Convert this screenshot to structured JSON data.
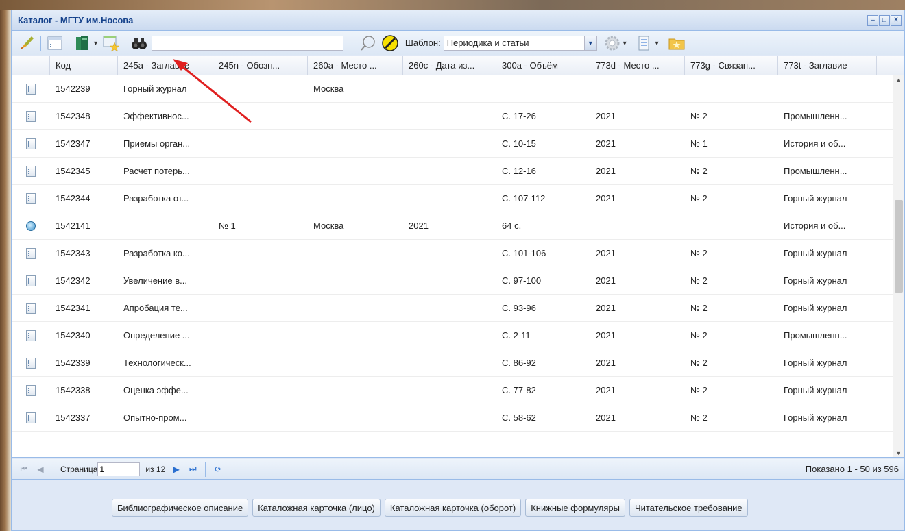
{
  "window": {
    "title": "Каталог - МГТУ им.Носова",
    "controls": [
      "–",
      "□",
      "✕"
    ]
  },
  "toolbar": {
    "search_value": "",
    "template_label": "Шаблон:",
    "template_value": "Периодика и статьи",
    "icons": [
      "edit-brush-icon",
      "record-view-icon",
      "books-icon",
      "favorite-record-icon",
      "binoculars-icon",
      "search-icon",
      "clear-icon",
      "settings-icon",
      "export-icon",
      "folder-star-icon"
    ]
  },
  "grid": {
    "columns": [
      "",
      "Код",
      "245a - Заглавие",
      "245n - Обозн...",
      "260a - Место ...",
      "260c - Дата из...",
      "300a - Объём",
      "773d - Место ...",
      "773g - Связан...",
      "773t - Заглавие"
    ],
    "rows": [
      {
        "icon": "doc",
        "code": "1542239",
        "title": "Горный журнал",
        "n": "",
        "place": "Москва",
        "date": "",
        "volume": "",
        "m773d": "",
        "m773g": "",
        "m773t": ""
      },
      {
        "icon": "doc",
        "code": "1542348",
        "title": "Эффективнос...",
        "n": "",
        "place": "",
        "date": "",
        "volume": "С. 17-26",
        "m773d": "2021",
        "m773g": "№ 2",
        "m773t": "Промышленн..."
      },
      {
        "icon": "doc",
        "code": "1542347",
        "title": "Приемы орган...",
        "n": "",
        "place": "",
        "date": "",
        "volume": "С. 10-15",
        "m773d": "2021",
        "m773g": "№ 1",
        "m773t": "История и об..."
      },
      {
        "icon": "doc",
        "code": "1542345",
        "title": "Расчет потерь...",
        "n": "",
        "place": "",
        "date": "",
        "volume": "С. 12-16",
        "m773d": "2021",
        "m773g": "№ 2",
        "m773t": "Промышленн..."
      },
      {
        "icon": "doc",
        "code": "1542344",
        "title": "Разработка от...",
        "n": "",
        "place": "",
        "date": "",
        "volume": "С. 107-112",
        "m773d": "2021",
        "m773g": "№ 2",
        "m773t": "Горный журнал"
      },
      {
        "icon": "globe",
        "code": "1542141",
        "title": "",
        "n": "№ 1",
        "place": "Москва",
        "date": "2021",
        "volume": "64 с.",
        "m773d": "",
        "m773g": "",
        "m773t": "История и об..."
      },
      {
        "icon": "doc",
        "code": "1542343",
        "title": "Разработка ко...",
        "n": "",
        "place": "",
        "date": "",
        "volume": "С. 101-106",
        "m773d": "2021",
        "m773g": "№ 2",
        "m773t": "Горный журнал"
      },
      {
        "icon": "doc",
        "code": "1542342",
        "title": "Увеличение в...",
        "n": "",
        "place": "",
        "date": "",
        "volume": "С. 97-100",
        "m773d": "2021",
        "m773g": "№ 2",
        "m773t": "Горный журнал"
      },
      {
        "icon": "doc",
        "code": "1542341",
        "title": "Апробация те...",
        "n": "",
        "place": "",
        "date": "",
        "volume": "С. 93-96",
        "m773d": "2021",
        "m773g": "№ 2",
        "m773t": "Горный журнал"
      },
      {
        "icon": "doc",
        "code": "1542340",
        "title": "Определение ...",
        "n": "",
        "place": "",
        "date": "",
        "volume": "С. 2-11",
        "m773d": "2021",
        "m773g": "№ 2",
        "m773t": "Промышленн..."
      },
      {
        "icon": "doc",
        "code": "1542339",
        "title": "Технологическ...",
        "n": "",
        "place": "",
        "date": "",
        "volume": "С. 86-92",
        "m773d": "2021",
        "m773g": "№ 2",
        "m773t": "Горный журнал"
      },
      {
        "icon": "doc",
        "code": "1542338",
        "title": "Оценка эффе...",
        "n": "",
        "place": "",
        "date": "",
        "volume": "С. 77-82",
        "m773d": "2021",
        "m773g": "№ 2",
        "m773t": "Горный журнал"
      },
      {
        "icon": "doc",
        "code": "1542337",
        "title": "Опытно-пром...",
        "n": "",
        "place": "",
        "date": "",
        "volume": "С. 58-62",
        "m773d": "2021",
        "m773g": "№ 2",
        "m773t": "Горный журнал"
      }
    ]
  },
  "pager": {
    "page_label": "Страница",
    "page_value": "1",
    "of_text": "из 12",
    "status": "Показано 1 - 50 из 596"
  },
  "buttons": {
    "bib": "Библиографическое описание",
    "card_front": "Каталожная карточка (лицо)",
    "card_back": "Каталожная карточка (оборот)",
    "forms": "Книжные формуляры",
    "reader_request": "Читательское требование"
  },
  "colors": {
    "title_text": "#15428b",
    "panel_border": "#99bbe8",
    "arrow_annotation": "#e02020"
  }
}
